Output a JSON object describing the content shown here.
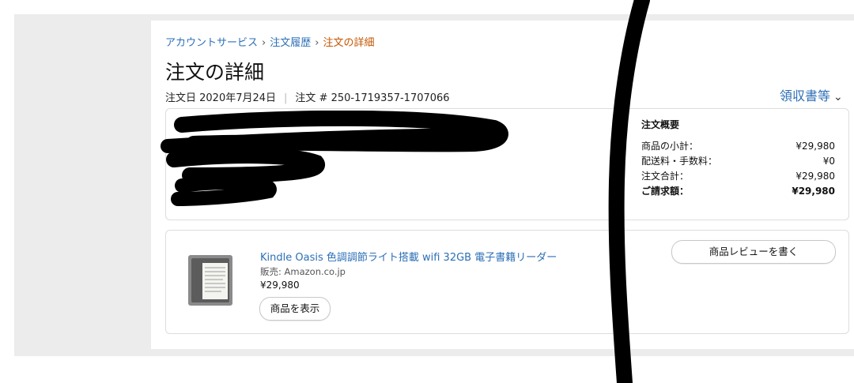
{
  "breadcrumb": {
    "item1": "アカウントサービス",
    "sep": "›",
    "item2": "注文履歴",
    "current": "注文の詳細"
  },
  "page": {
    "title": "注文の詳細",
    "order_date": "注文日 2020年7月24日",
    "order_number": "注文 # 250-1719357-1707066",
    "receipt_label": "領収書等"
  },
  "summary": {
    "heading": "注文概要",
    "rows": [
      {
        "label": "商品の小計：",
        "value": "¥29,980"
      },
      {
        "label": "配送料・手数料：",
        "value": "¥0"
      },
      {
        "label": "注文合計：",
        "value": "¥29,980"
      },
      {
        "label": "ご請求額：",
        "value": "¥29,980"
      }
    ]
  },
  "item": {
    "title": "Kindle Oasis 色調調節ライト搭載 wifi 32GB 電子書籍リーダー",
    "seller": "販売: Amazon.co.jp",
    "price": "¥29,980",
    "view_button": "商品を表示",
    "review_button": "商品レビューを書く"
  },
  "colors": {
    "link": "#2c6fb7",
    "current_breadcrumb": "#c45500",
    "background": "#ececec"
  }
}
